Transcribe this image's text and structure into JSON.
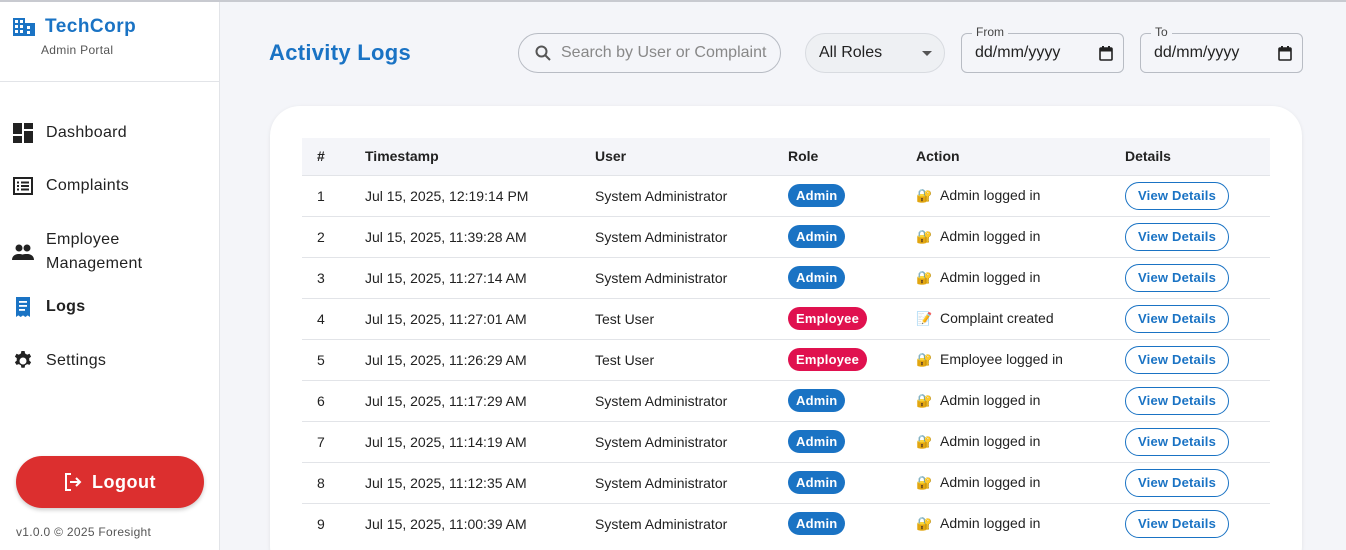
{
  "brand": {
    "name": "TechCorp",
    "subtitle": "Admin Portal",
    "icon": "building-icon"
  },
  "sidebar": {
    "items": [
      {
        "label": "Dashboard",
        "icon": "dashboard-icon",
        "active": false
      },
      {
        "label": "Complaints",
        "icon": "list-icon",
        "active": false
      },
      {
        "label": "Employee Management",
        "icon": "people-icon",
        "active": false
      },
      {
        "label": "Logs",
        "icon": "receipt-icon",
        "active": true
      },
      {
        "label": "Settings",
        "icon": "gear-icon",
        "active": false
      }
    ],
    "logout_label": "Logout",
    "version": "v1.0.0 © 2025 Foresight"
  },
  "header": {
    "title": "Activity Logs",
    "search_placeholder": "Search by User or Complaint",
    "role_filter": "All Roles",
    "from_label": "From",
    "from_value": "dd/mm/yyyy",
    "to_label": "To",
    "to_value": "dd/mm/yyyy"
  },
  "table": {
    "headers": [
      "#",
      "Timestamp",
      "User",
      "Role",
      "Action",
      "Details"
    ],
    "rows": [
      {
        "num": "1",
        "timestamp": "Jul 15, 2025, 12:19:14 PM",
        "user": "System Administrator",
        "role": "Admin",
        "action_icon": "🔐",
        "action": "Admin logged in",
        "details": "View Details"
      },
      {
        "num": "2",
        "timestamp": "Jul 15, 2025, 11:39:28 AM",
        "user": "System Administrator",
        "role": "Admin",
        "action_icon": "🔐",
        "action": "Admin logged in",
        "details": "View Details"
      },
      {
        "num": "3",
        "timestamp": "Jul 15, 2025, 11:27:14 AM",
        "user": "System Administrator",
        "role": "Admin",
        "action_icon": "🔐",
        "action": "Admin logged in",
        "details": "View Details"
      },
      {
        "num": "4",
        "timestamp": "Jul 15, 2025, 11:27:01 AM",
        "user": "Test User",
        "role": "Employee",
        "action_icon": "📝",
        "action": "Complaint created",
        "details": "View Details"
      },
      {
        "num": "5",
        "timestamp": "Jul 15, 2025, 11:26:29 AM",
        "user": "Test User",
        "role": "Employee",
        "action_icon": "🔐",
        "action": "Employee logged in",
        "details": "View Details"
      },
      {
        "num": "6",
        "timestamp": "Jul 15, 2025, 11:17:29 AM",
        "user": "System Administrator",
        "role": "Admin",
        "action_icon": "🔐",
        "action": "Admin logged in",
        "details": "View Details"
      },
      {
        "num": "7",
        "timestamp": "Jul 15, 2025, 11:14:19 AM",
        "user": "System Administrator",
        "role": "Admin",
        "action_icon": "🔐",
        "action": "Admin logged in",
        "details": "View Details"
      },
      {
        "num": "8",
        "timestamp": "Jul 15, 2025, 11:12:35 AM",
        "user": "System Administrator",
        "role": "Admin",
        "action_icon": "🔐",
        "action": "Admin logged in",
        "details": "View Details"
      },
      {
        "num": "9",
        "timestamp": "Jul 15, 2025, 11:00:39 AM",
        "user": "System Administrator",
        "role": "Admin",
        "action_icon": "🔐",
        "action": "Admin logged in",
        "details": "View Details"
      }
    ]
  },
  "colors": {
    "accent": "#1a73c4",
    "admin_badge": "#1a73c4",
    "employee_badge": "#e0114f",
    "logout": "#dc2f2f"
  }
}
